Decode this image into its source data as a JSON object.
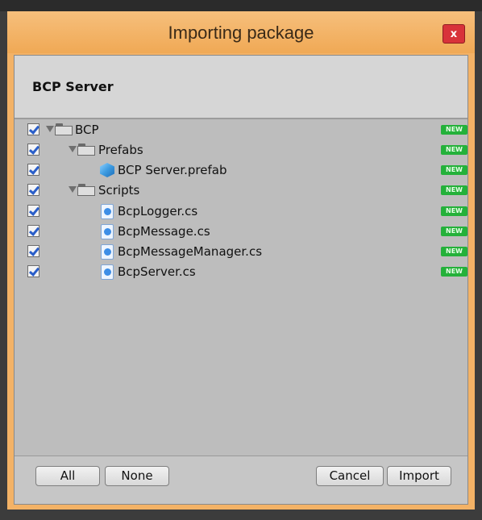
{
  "window": {
    "title": "Importing package",
    "close_label": "x"
  },
  "package": {
    "name": "BCP Server"
  },
  "tree": [
    {
      "label": "BCP",
      "type": "folder",
      "checked": true,
      "badge": "NEW"
    },
    {
      "label": "Prefabs",
      "type": "folder",
      "checked": true,
      "badge": "NEW"
    },
    {
      "label": "BCP Server.prefab",
      "type": "prefab",
      "checked": true,
      "badge": "NEW"
    },
    {
      "label": "Scripts",
      "type": "folder",
      "checked": true,
      "badge": "NEW"
    },
    {
      "label": "BcpLogger.cs",
      "type": "script",
      "checked": true,
      "badge": "NEW"
    },
    {
      "label": "BcpMessage.cs",
      "type": "script",
      "checked": true,
      "badge": "NEW"
    },
    {
      "label": "BcpMessageManager.cs",
      "type": "script",
      "checked": true,
      "badge": "NEW"
    },
    {
      "label": "BcpServer.cs",
      "type": "script",
      "checked": true,
      "badge": "NEW"
    }
  ],
  "buttons": {
    "all": "All",
    "none": "None",
    "cancel": "Cancel",
    "import": "Import"
  },
  "colors": {
    "accent": "#f3b266",
    "new_badge": "#24b13a",
    "close": "#d8323a"
  },
  "icons": {
    "folder": "folder-icon",
    "prefab": "prefab-cube-icon",
    "script": "csharp-script-icon",
    "expand": "expand-arrow-icon"
  }
}
